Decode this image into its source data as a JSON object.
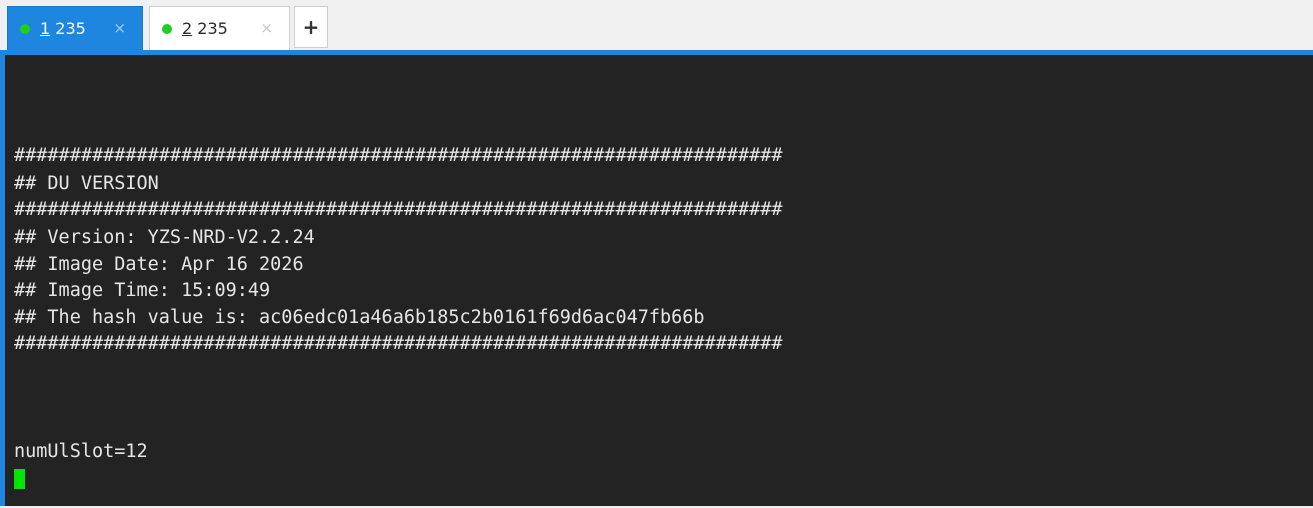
{
  "tabs": [
    {
      "number": "1",
      "label": " 235",
      "close": "×",
      "status_color": "#22cc22",
      "active": true
    },
    {
      "number": "2",
      "label": " 235",
      "close": "×",
      "status_color": "#22cc22",
      "active": false
    }
  ],
  "new_tab_label": "+",
  "terminal": {
    "lines": [
      "#####################################################################",
      "## DU VERSION",
      "#####################################################################",
      "## Version: YZS-NRD-V2.2.24",
      "## Image Date: Apr 16 2026",
      "## Image Time: 15:09:49",
      "## The hash value is: ac06edc01a46a6b185c2b0161f69d6ac047fb66b",
      "#####################################################################",
      "numUlSlot=12"
    ],
    "cursor_color": "#00e600",
    "background": "#232323"
  },
  "accent_color": "#1f86e0"
}
